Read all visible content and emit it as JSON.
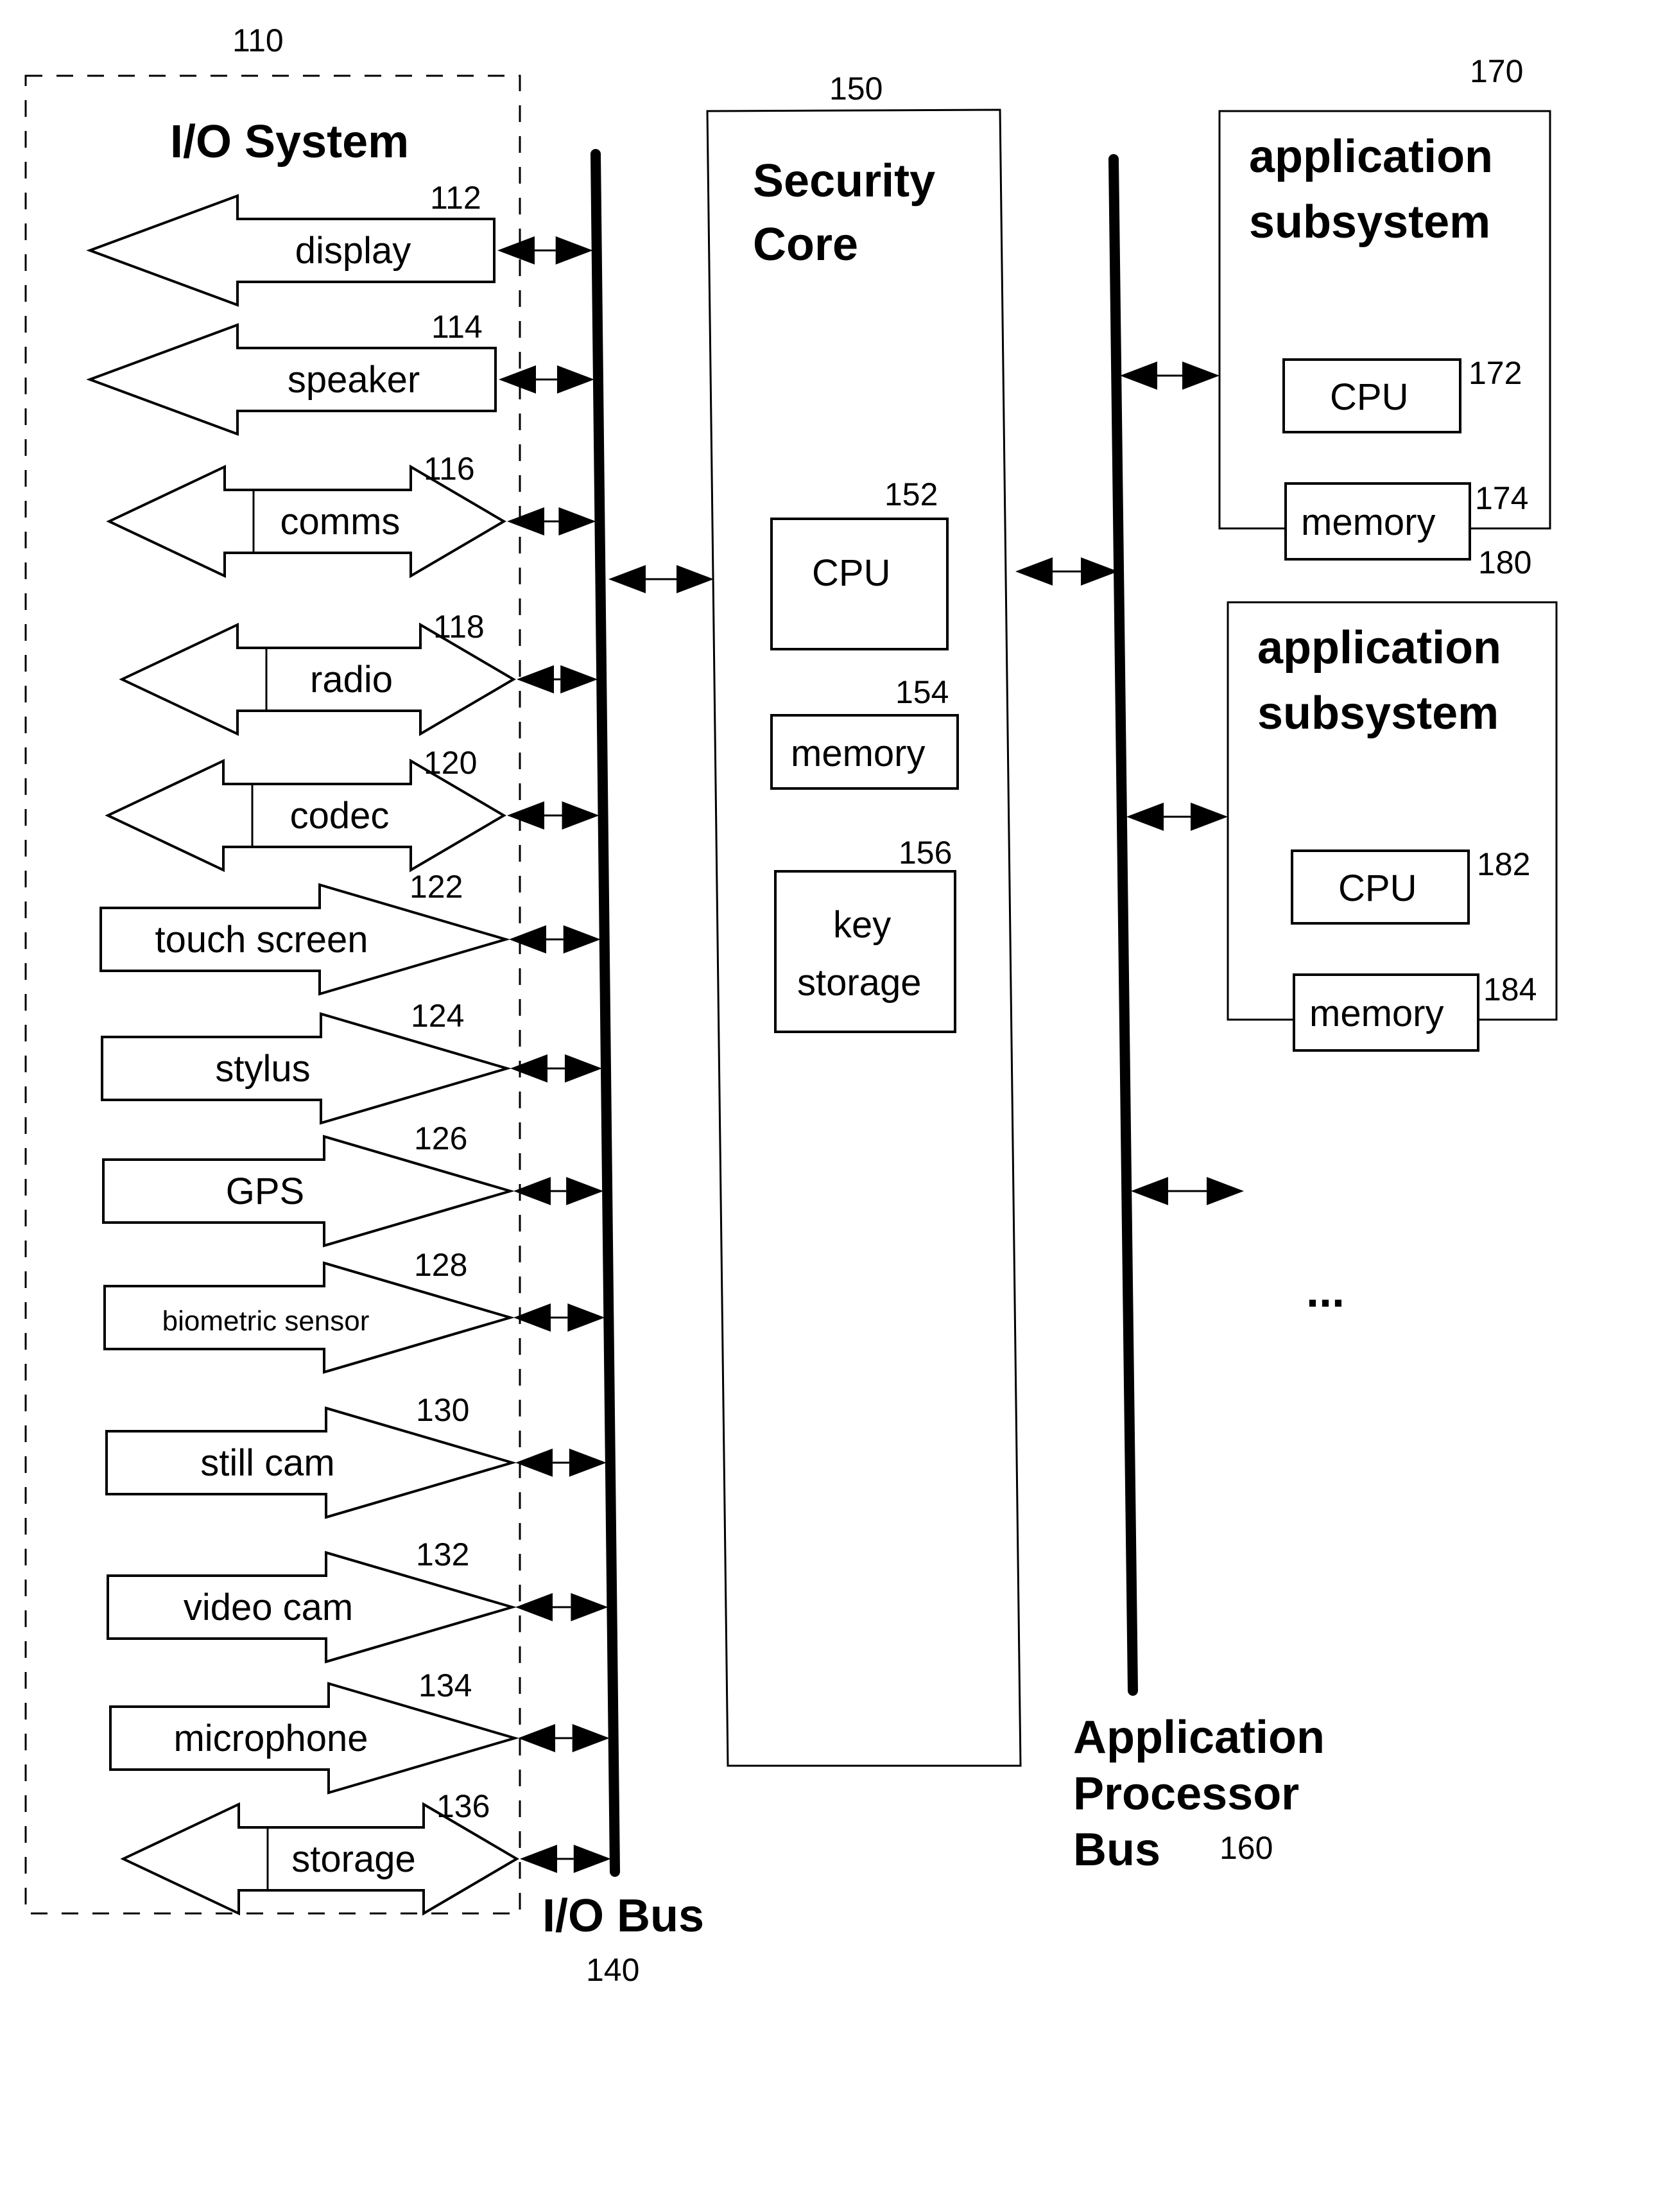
{
  "io_system": {
    "ref": "110",
    "title": "I/O System",
    "devices": [
      {
        "ref": "112",
        "label": "display",
        "direction": "out"
      },
      {
        "ref": "114",
        "label": "speaker",
        "direction": "out"
      },
      {
        "ref": "116",
        "label": "comms",
        "direction": "bidirectional"
      },
      {
        "ref": "118",
        "label": "radio",
        "direction": "bidirectional"
      },
      {
        "ref": "120",
        "label": "codec",
        "direction": "bidirectional"
      },
      {
        "ref": "122",
        "label": "touch screen",
        "direction": "in"
      },
      {
        "ref": "124",
        "label": "stylus",
        "direction": "in"
      },
      {
        "ref": "126",
        "label": "GPS",
        "direction": "in"
      },
      {
        "ref": "128",
        "label": "biometric sensor",
        "direction": "in"
      },
      {
        "ref": "130",
        "label": "still cam",
        "direction": "in"
      },
      {
        "ref": "132",
        "label": "video cam",
        "direction": "in"
      },
      {
        "ref": "134",
        "label": "microphone",
        "direction": "in"
      },
      {
        "ref": "136",
        "label": "storage",
        "direction": "bidirectional"
      }
    ]
  },
  "io_bus": {
    "ref": "140",
    "label": "I/O Bus"
  },
  "security_core": {
    "ref": "150",
    "title_line1": "Security",
    "title_line2": "Core",
    "cpu": {
      "ref": "152",
      "label": "CPU"
    },
    "memory": {
      "ref": "154",
      "label": "memory"
    },
    "key_storage": {
      "ref": "156",
      "label_line1": "key",
      "label_line2": "storage"
    }
  },
  "ap_bus": {
    "ref": "160",
    "label_line1": "Application",
    "label_line2": "Processor",
    "label_line3": "Bus"
  },
  "app_subsystems": [
    {
      "ref": "170",
      "title_line1": "application",
      "title_line2": "subsystem",
      "cpu": {
        "ref": "172",
        "label": "CPU"
      },
      "memory": {
        "ref": "174",
        "label": "memory"
      }
    },
    {
      "ref": "180",
      "title_line1": "application",
      "title_line2": "subsystem",
      "cpu": {
        "ref": "182",
        "label": "CPU"
      },
      "memory": {
        "ref": "184",
        "label": "memory"
      }
    }
  ],
  "ellipsis": "..."
}
